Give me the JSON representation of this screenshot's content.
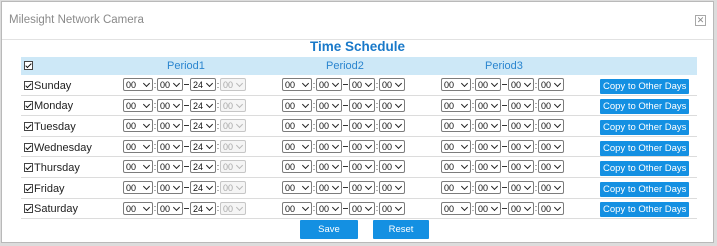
{
  "window": {
    "title": "Milesight Network Camera",
    "close_glyph": "✕"
  },
  "panel_title": "Time Schedule",
  "header": {
    "period_labels": [
      "Period1",
      "Period2",
      "Period3"
    ]
  },
  "days": [
    {
      "label": "Sunday",
      "checked": true
    },
    {
      "label": "Monday",
      "checked": true
    },
    {
      "label": "Tuesday",
      "checked": true
    },
    {
      "label": "Wednesday",
      "checked": true
    },
    {
      "label": "Thursday",
      "checked": true
    },
    {
      "label": "Friday",
      "checked": true
    },
    {
      "label": "Saturday",
      "checked": true
    }
  ],
  "period_values": [
    {
      "start_h": "00",
      "start_m": "00",
      "end_h": "24",
      "end_m": "00",
      "end_m_disabled": true
    },
    {
      "start_h": "00",
      "start_m": "00",
      "end_h": "00",
      "end_m": "00",
      "end_m_disabled": false
    },
    {
      "start_h": "00",
      "start_m": "00",
      "end_h": "00",
      "end_m": "00",
      "end_m_disabled": false
    }
  ],
  "copy_label": "Copy to Other Days",
  "actions": {
    "save": "Save",
    "reset": "Reset"
  },
  "colors": {
    "accent": "#1490e2",
    "header_bg": "#cde8f7",
    "title_blue": "#1979c9"
  }
}
